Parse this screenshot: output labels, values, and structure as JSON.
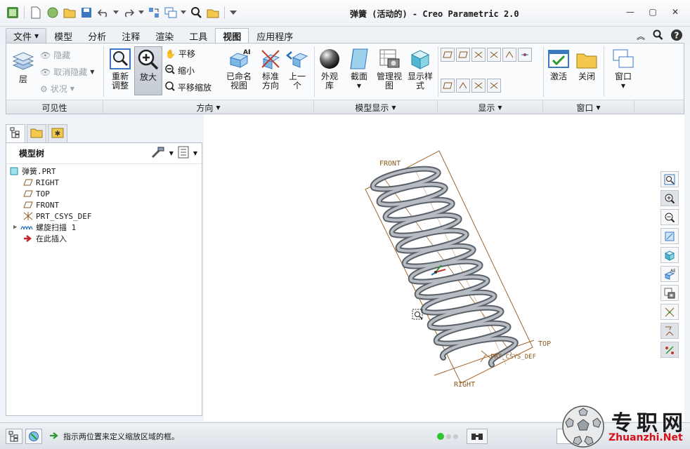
{
  "window": {
    "title": "弹簧 (活动的) - Creo Parametric 2.0"
  },
  "menu_tabs": [
    {
      "label": "文件",
      "has_dropdown": true
    },
    {
      "label": "模型"
    },
    {
      "label": "分析"
    },
    {
      "label": "注释"
    },
    {
      "label": "渲染"
    },
    {
      "label": "工具"
    },
    {
      "label": "视图",
      "active": true
    },
    {
      "label": "应用程序"
    }
  ],
  "ribbon": {
    "visibility": {
      "layer": "层",
      "hide": "隐藏",
      "unhide": "取消隐藏",
      "status": "状况",
      "group_label": "可见性"
    },
    "orientation": {
      "refit": "重新\n调整",
      "zoom_in": "放大",
      "pan": "平移",
      "zoom_out": "缩小",
      "pan_zoom": "平移缩放",
      "group_label": "方向"
    },
    "named_views": {
      "saved_views": "已命名\n视图",
      "standard_orientation": "标准\n方向",
      "previous": "上一\n个"
    },
    "model_display": {
      "appearance": "外观\n库",
      "section": "截面",
      "manage_views": "管理视\n图",
      "display_style": "显示样\n式",
      "group_label": "模型显示"
    },
    "show": {
      "group_label": "显示"
    },
    "window": {
      "activate": "激活",
      "close": "关闭",
      "windows": "窗口",
      "group_label": "窗口"
    }
  },
  "model_tree": {
    "title": "模型树",
    "items": [
      {
        "label": "弹簧.PRT",
        "icon": "part-icon",
        "indent": 0
      },
      {
        "label": "RIGHT",
        "icon": "datum-plane-icon",
        "indent": 1
      },
      {
        "label": "TOP",
        "icon": "datum-plane-icon",
        "indent": 1
      },
      {
        "label": "FRONT",
        "icon": "datum-plane-icon",
        "indent": 1
      },
      {
        "label": "PRT_CSYS_DEF",
        "icon": "csys-icon",
        "indent": 1
      },
      {
        "label": "螺旋扫描 1",
        "icon": "helical-sweep-icon",
        "indent": 1,
        "expandable": true
      },
      {
        "label": "在此插入",
        "icon": "insert-arrow-icon",
        "indent": 1
      }
    ]
  },
  "graphics": {
    "datum_labels": {
      "front": "FRONT",
      "top": "TOP",
      "right": "RIGHT",
      "csys": "PRT_CSYS_DEF"
    }
  },
  "status_bar": {
    "message": "指示两位置来定义缩放区域的框。"
  },
  "watermark": {
    "cn": "专职网",
    "en": "Zhuanzhi.Net"
  },
  "colors": {
    "accent": "#2a6fb5",
    "spring": "#8e949c",
    "datum": "#a0662a"
  }
}
